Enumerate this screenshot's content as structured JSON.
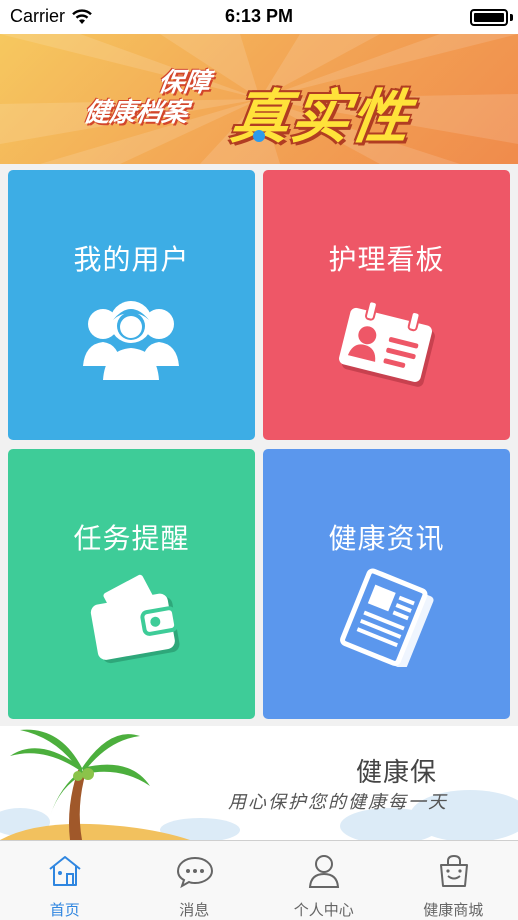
{
  "status_bar": {
    "carrier": "Carrier",
    "time": "6:13 PM"
  },
  "banner": {
    "line1": "保障",
    "line2": "健康档案",
    "big": "真实性"
  },
  "tiles": [
    {
      "title": "我的用户",
      "icon": "users-icon",
      "color": "#3dade5"
    },
    {
      "title": "护理看板",
      "icon": "id-card-icon",
      "color": "#ee5767"
    },
    {
      "title": "任务提醒",
      "icon": "wallet-icon",
      "color": "#3ecc98"
    },
    {
      "title": "健康资讯",
      "icon": "newspaper-icon",
      "color": "#5b97ed"
    }
  ],
  "promo": {
    "brand": "健康保",
    "slogan": "用心保护您的健康每一天"
  },
  "tabbar": {
    "active_color": "#2f86e0",
    "items": [
      {
        "label": "首页",
        "icon": "home-icon",
        "active": true
      },
      {
        "label": "消息",
        "icon": "chat-bubble-icon",
        "active": false
      },
      {
        "label": "个人中心",
        "icon": "person-icon",
        "active": false
      },
      {
        "label": "健康商城",
        "icon": "shopping-bag-icon",
        "active": false
      }
    ]
  }
}
